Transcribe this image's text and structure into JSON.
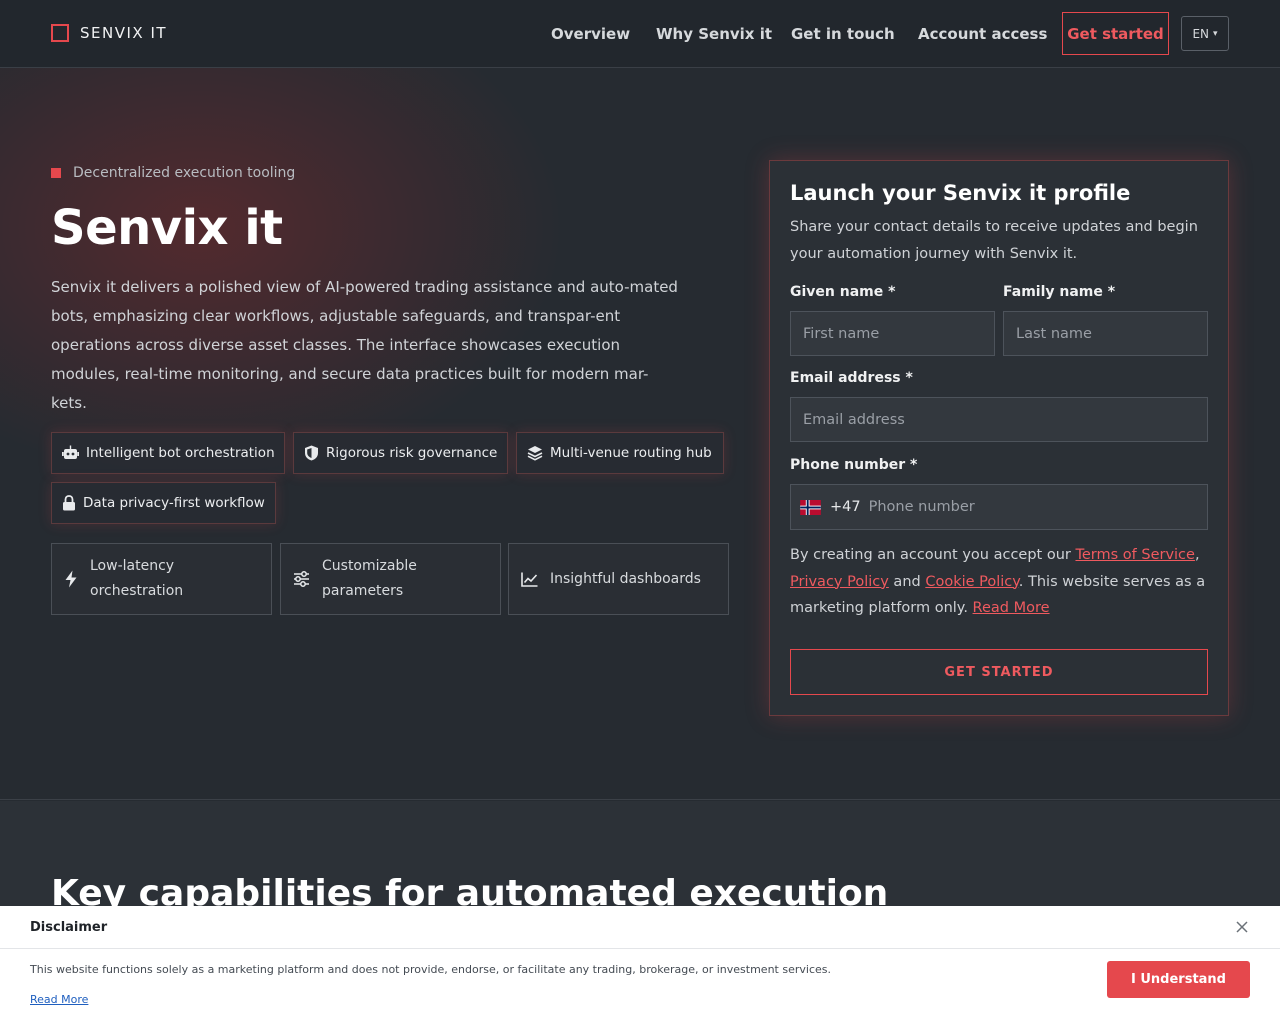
{
  "brand": {
    "name": "SENVIX IT"
  },
  "nav": {
    "items": [
      "Overview",
      "Why Senvix it",
      "Get in touch",
      "Account access"
    ],
    "cta": "Get started",
    "language": "EN"
  },
  "hero": {
    "eyebrow": "Decentralized execution tooling",
    "title": "Senvix it",
    "description": "Senvix it delivers a polished view of AI-powered trading assistance and auto-mated bots, emphasizing clear workflows, adjustable safeguards, and transpar-ent operations across diverse asset classes. The interface showcases execution modules, real-time monitoring, and secure data practices built for modern mar-kets.",
    "pills": [
      {
        "label": "Intelligent bot orchestration",
        "icon": "robot-icon"
      },
      {
        "label": "Rigorous risk governance",
        "icon": "shield-icon"
      },
      {
        "label": "Multi-venue routing hub",
        "icon": "layers-icon"
      },
      {
        "label": "Data privacy-first workflow",
        "icon": "lock-icon"
      }
    ],
    "features": [
      {
        "label": "Low-latency orchestration",
        "icon": "bolt-icon"
      },
      {
        "label": "Customizable parameters",
        "icon": "sliders-icon"
      },
      {
        "label": "Insightful dashboards",
        "icon": "chart-line-icon"
      }
    ]
  },
  "form": {
    "title": "Launch your Senvix it profile",
    "subtitle": "Share your contact details to receive updates and begin your automation journey with Senvix it.",
    "given_name_label": "Given name *",
    "given_name_placeholder": "First name",
    "family_name_label": "Family name *",
    "family_name_placeholder": "Last name",
    "email_label": "Email address *",
    "email_placeholder": "Email address",
    "phone_label": "Phone number *",
    "phone_dial_code": "+47",
    "phone_placeholder": "Phone number",
    "consent_prefix": "By creating an account you accept our ",
    "terms_link": "Terms of Service",
    "comma": ",",
    "privacy_link": "Privacy Policy",
    "and": " and ",
    "cookie_link": "Cookie Policy",
    "consent_suffix": ". This website serves as a marketing platform only. ",
    "read_more_link": "Read More",
    "submit": "GET STARTED"
  },
  "section2": {
    "title": "Key capabilities for automated execution"
  },
  "disclaimer": {
    "title": "Disclaimer",
    "text": "This website functions solely as a marketing platform and does not provide, endorse, or facilitate any trading, brokerage, or investment services.",
    "read_more": "Read More",
    "button": "I Understand"
  },
  "colors": {
    "accent": "#e5484d",
    "background": "#262b31",
    "link_blue": "#1f5fbf"
  }
}
